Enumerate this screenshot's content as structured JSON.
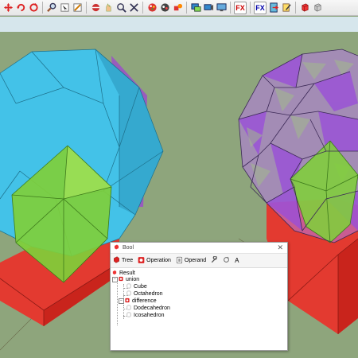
{
  "toolbar": {
    "icons": [
      "move-icon",
      "rotate-icon",
      "refresh-icon",
      "zoom-icon",
      "select-icon",
      "measure-icon",
      "orbit-icon",
      "pan-icon",
      "zoom-window-icon",
      "zoom-extents-icon",
      "paint-icon",
      "color-icon",
      "shapes-icon",
      "view-icon",
      "camera-icon",
      "export-icon",
      "import-icon",
      "file-icon",
      "edit-icon",
      "bool-icon",
      "extrude-icon"
    ],
    "fx1_label": "FX",
    "fx2_label": "FX"
  },
  "dialog": {
    "title": "Bool",
    "close_glyph": "✕",
    "tools": {
      "tree_label": "Tree",
      "operation_label": "Operation",
      "operand_label": "Operand",
      "font_glyph": "A"
    },
    "tree": {
      "result": "Result",
      "union": "union",
      "cube": "Cube",
      "octahedron": "Octahedron",
      "difference": "difference",
      "dodecahedron": "Dodecahedron",
      "icosahedron": "Icosahedron"
    },
    "expander": "−"
  },
  "colors": {
    "sky": "#d6e6ec",
    "ground": "#8ea57c",
    "red_solid": "#e5352b",
    "cyan_solid": "#3fc3ea",
    "green_solid": "#7fd03a",
    "purple_solid": "#a355dd"
  }
}
